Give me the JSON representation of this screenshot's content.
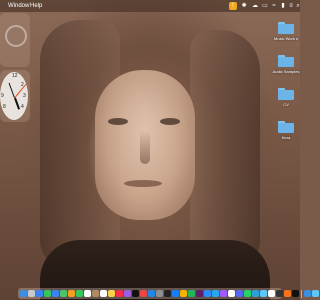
{
  "menubar": {
    "items": [
      "Window",
      "Help"
    ],
    "status_icons": [
      "warning-icon",
      "settings-icon",
      "cloud-icon",
      "notification-icon",
      "wifi-icon",
      "battery-icon",
      "control-center-icon",
      "search-icon"
    ]
  },
  "desktop": {
    "folders": [
      {
        "label": "Music Work s"
      },
      {
        "label": "Audio Samples"
      },
      {
        "label": "CV"
      },
      {
        "label": "Nora"
      }
    ]
  },
  "widgets": {
    "clock": {
      "numbers": [
        "12",
        "2",
        "3",
        "4",
        "8",
        "9"
      ]
    }
  },
  "dock": {
    "apps": [
      "finder",
      "launchpad",
      "safari",
      "messages",
      "mail",
      "maps",
      "photos",
      "facetime",
      "calendar",
      "contacts",
      "reminders",
      "notes",
      "music",
      "podcasts",
      "tv",
      "news",
      "app-store",
      "system-preferences",
      "terminal",
      "xcode",
      "chrome",
      "spotify",
      "slack",
      "zoom",
      "vscode",
      "figma",
      "notion",
      "discord",
      "whatsapp",
      "telegram",
      "preview",
      "textedit",
      "logic-pro",
      "garageband",
      "ableton",
      "finder-2",
      "downloads",
      "trash"
    ],
    "colors": [
      "#3a8ee6",
      "#c8c8d0",
      "#3b82f6",
      "#34c759",
      "#3b82f6",
      "#4cc36a",
      "#f4a01c",
      "#34c759",
      "#ffffff",
      "#b08968",
      "#ffffff",
      "#f7d24b",
      "#fa2d48",
      "#9b5de5",
      "#111111",
      "#ef4444",
      "#1e88e5",
      "#8e8e93",
      "#222222",
      "#147efb",
      "#f4b400",
      "#1db954",
      "#611f69",
      "#2d8cff",
      "#23a8f2",
      "#a259ff",
      "#ffffff",
      "#5865f2",
      "#25d366",
      "#2aa1da",
      "#5ac8fa",
      "#ffffff",
      "#333333",
      "#f97316",
      "#111111",
      "#3a8ee6",
      "#5ac8fa",
      "#9ca3af"
    ]
  }
}
